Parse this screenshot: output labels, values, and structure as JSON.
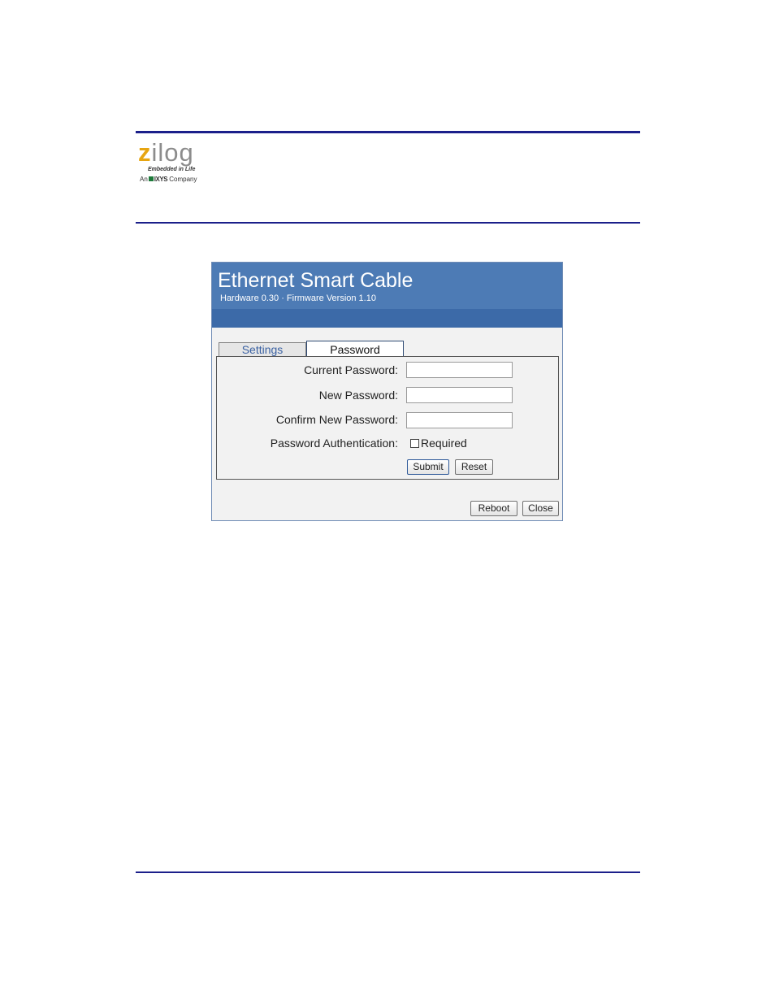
{
  "logo": {
    "wordmark_z": "z",
    "wordmark_rest": "ilog",
    "tagline": "Embedded in Life",
    "company_prefix": "An",
    "company_name": "IXYS",
    "company_suffix": "Company",
    "brand_color": "#e7a511"
  },
  "window": {
    "title": "Ethernet Smart Cable",
    "subtitle": "Hardware 0.30 · Firmware Version 1.10",
    "header_color": "#4d7bb5"
  },
  "tabs": [
    {
      "label": "Settings",
      "active": false
    },
    {
      "label": "Password",
      "active": true
    }
  ],
  "form": {
    "current_password_label": "Current Password:",
    "current_password_value": "",
    "new_password_label": "New Password:",
    "new_password_value": "",
    "confirm_password_label": "Confirm New Password:",
    "confirm_password_value": "",
    "auth_label": "Password Authentication:",
    "required_label": "Required",
    "required_checked": false,
    "submit_label": "Submit",
    "reset_label": "Reset"
  },
  "footer": {
    "reboot_label": "Reboot",
    "close_label": "Close"
  }
}
